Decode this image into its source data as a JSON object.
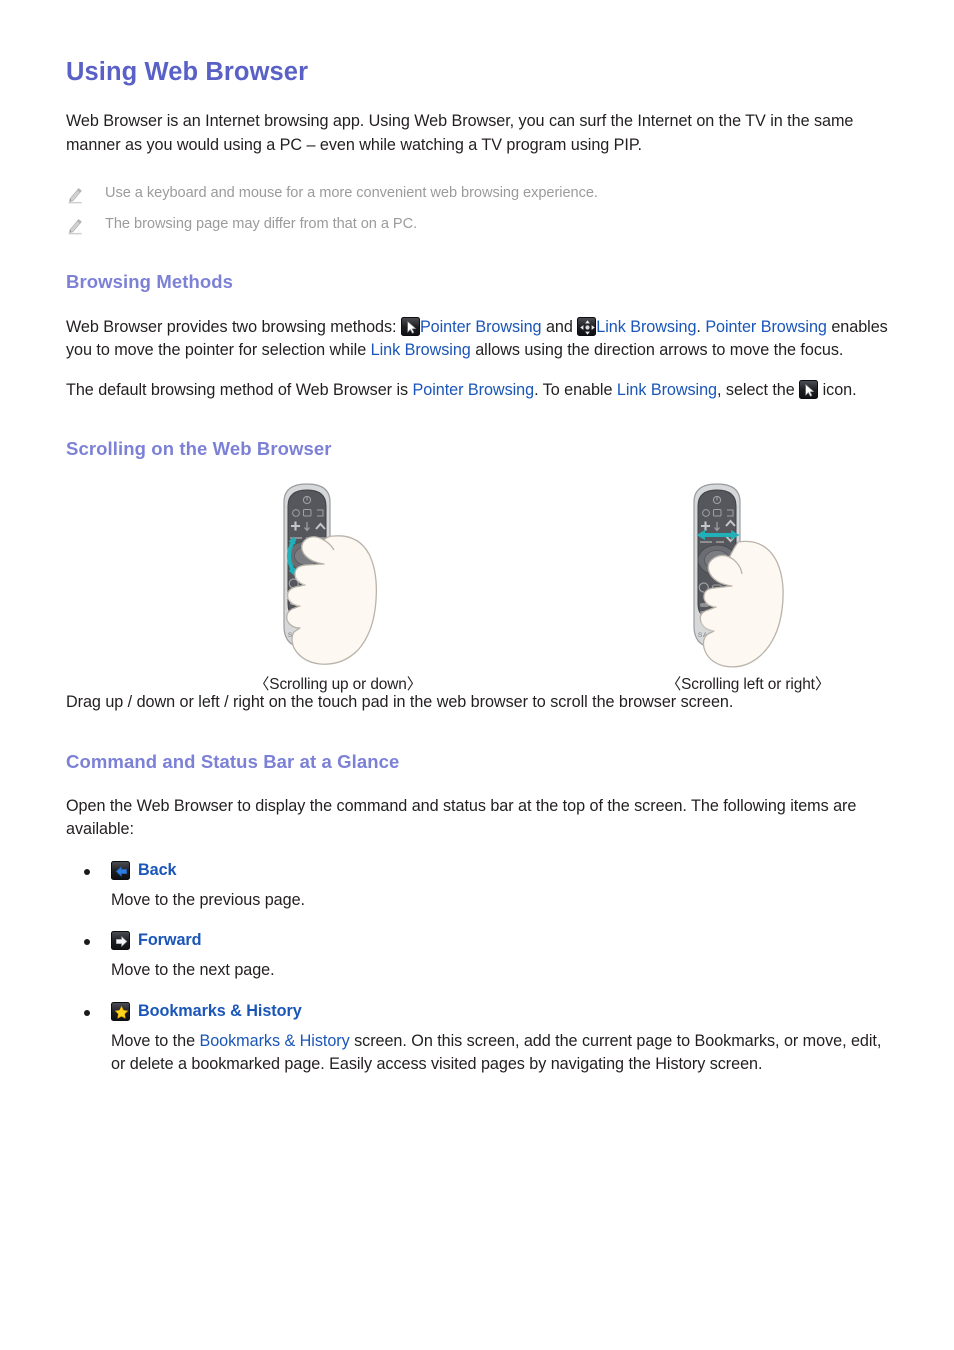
{
  "document": {
    "title": "Using Web Browser",
    "intro": "Web Browser is an Internet browsing app. Using Web Browser, you can surf the Internet on the TV in the same manner as you would using a PC – even while watching a TV program using PIP.",
    "notes": [
      "Use a keyboard and mouse for a more convenient web browsing experience.",
      "The browsing page may differ from that on a PC."
    ]
  },
  "browsing_methods": {
    "heading": "Browsing Methods",
    "para1": {
      "seg1": "Web Browser provides two browsing methods: ",
      "link1": "Pointer Browsing",
      "seg2": " and ",
      "link2": "Link Browsing",
      "seg3": ". ",
      "link3": "Pointer Browsing",
      "seg4": " enables you to move the pointer for selection while ",
      "link4": "Link Browsing",
      "seg5": " allows using the direction arrows to move the focus."
    },
    "para2": {
      "seg1": "The default browsing method of Web Browser is ",
      "link1": "Pointer Browsing",
      "seg2": ". To enable ",
      "link2": "Link Browsing",
      "seg3": ", select the ",
      "seg4": " icon."
    },
    "icons": {
      "pointer": "pointer-browsing-icon",
      "link": "link-browsing-icon"
    }
  },
  "scrolling": {
    "heading": "Scrolling on the Web Browser",
    "figures": [
      {
        "caption": "〈Scrolling up or down〉",
        "name": "remote-scroll-vertical"
      },
      {
        "caption": "〈Scrolling left or right〉",
        "name": "remote-scroll-horizontal"
      }
    ],
    "caption_text": "Drag up / down or left / right on the touch pad in the web browser to scroll the browser screen.",
    "brand": "SAMSUNG"
  },
  "command_bar": {
    "heading": "Command and Status Bar at a Glance",
    "intro": "Open the Web Browser to display the command and status bar at the top of the screen. The following items are available:",
    "items": [
      {
        "icon": "back-arrow-icon",
        "label": "Back",
        "desc_seg1": "Move to the previous page.",
        "desc_link": "",
        "desc_seg2": ""
      },
      {
        "icon": "forward-arrow-icon",
        "label": "Forward",
        "desc_seg1": "Move to the next page.",
        "desc_link": "",
        "desc_seg2": ""
      },
      {
        "icon": "star-icon",
        "label": "Bookmarks & History",
        "desc_seg1": "Move to the ",
        "desc_link": "Bookmarks & History",
        "desc_seg2": " screen. On this screen, add the current page to Bookmarks, or move, edit, or delete a bookmarked page. Easily access visited pages by navigating the History screen."
      }
    ]
  },
  "colors": {
    "title": "#5a61c6",
    "section_heading": "#7c81d6",
    "link": "#1a55b8",
    "body_text": "#231f20",
    "note_text": "#9b9b9b",
    "accent_teal": "#22b0b8",
    "star_yellow": "#ffd320"
  }
}
